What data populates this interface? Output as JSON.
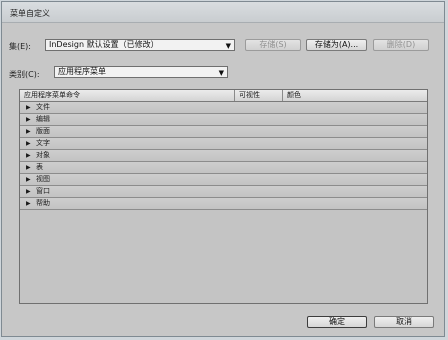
{
  "dialog": {
    "title": "菜单自定义"
  },
  "set": {
    "label": "集(E):",
    "value": "InDesign 默认设置（已修改）"
  },
  "buttons": {
    "save": "存储(S)",
    "save_as": "存储为(A)...",
    "delete": "删除(D)",
    "ok": "确定",
    "cancel": "取消"
  },
  "category": {
    "label": "类别(C):",
    "value": "应用程序菜单"
  },
  "table": {
    "headers": [
      "应用程序菜单命令",
      "可视性",
      "颜色"
    ],
    "rows": [
      {
        "label": "文件"
      },
      {
        "label": "编辑"
      },
      {
        "label": "版面"
      },
      {
        "label": "文字"
      },
      {
        "label": "对象"
      },
      {
        "label": "表"
      },
      {
        "label": "视图"
      },
      {
        "label": "窗口"
      },
      {
        "label": "帮助"
      }
    ]
  }
}
